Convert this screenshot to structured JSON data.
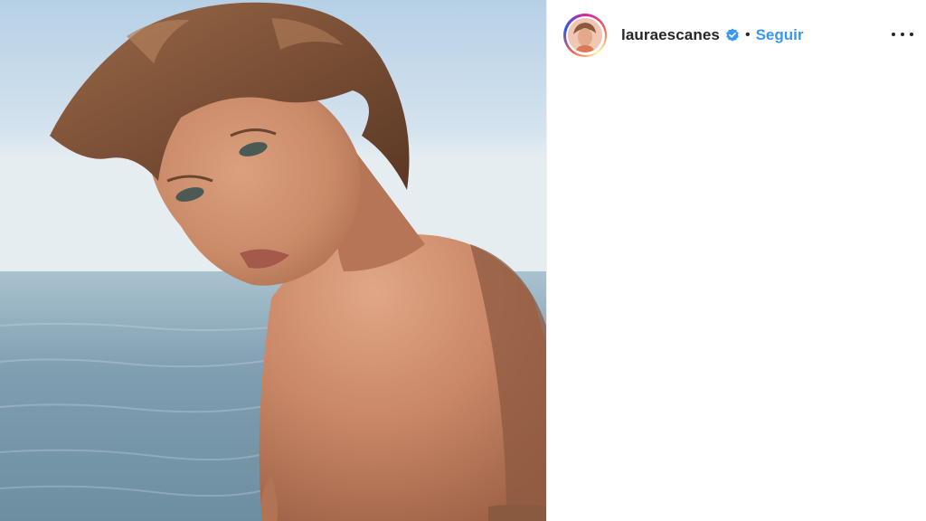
{
  "post": {
    "username": "lauraescanes",
    "follow_label": "Seguir",
    "separator": "•",
    "verified_icon": "verified-badge-icon",
    "more_icon": "more-options-icon"
  },
  "colors": {
    "follow_blue": "#3897f0",
    "verified_blue": "#3897f0",
    "text": "#262626"
  }
}
